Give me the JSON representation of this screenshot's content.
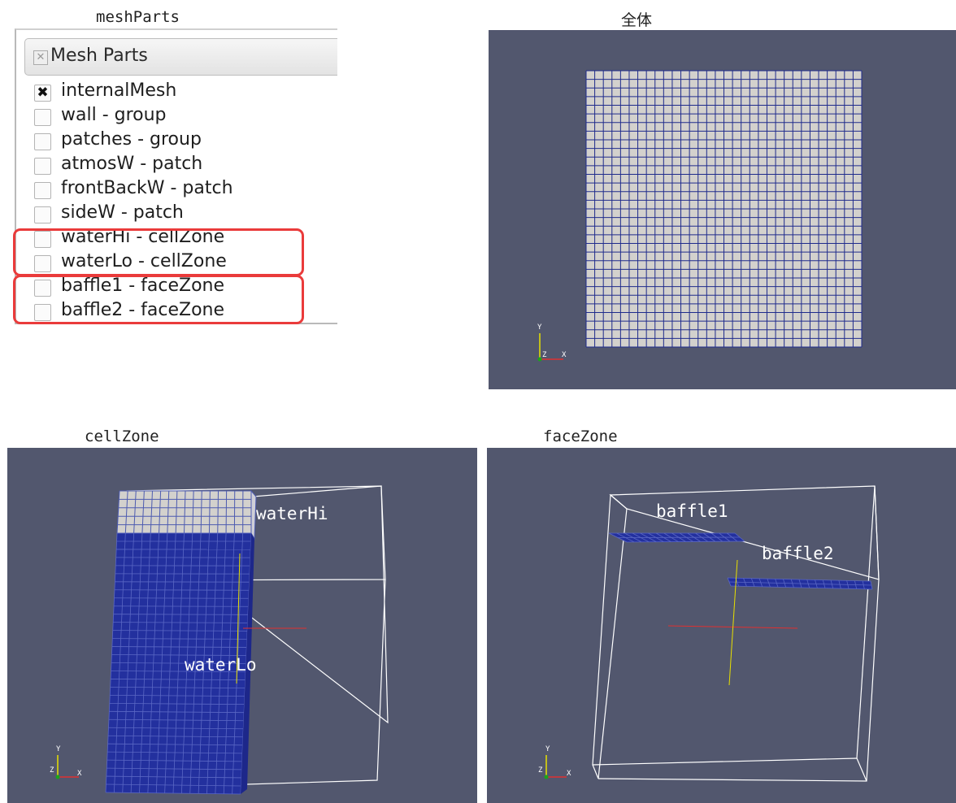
{
  "captions": {
    "meshparts": "meshParts",
    "overall": "全体",
    "cellzone": "cellZone",
    "facezone": "faceZone"
  },
  "mesh_parts_panel": {
    "header": "Mesh Parts",
    "items": [
      {
        "label": "internalMesh",
        "checked": true
      },
      {
        "label": "wall - group",
        "checked": false
      },
      {
        "label": "patches - group",
        "checked": false
      },
      {
        "label": "atmosW - patch",
        "checked": false
      },
      {
        "label": "frontBackW - patch",
        "checked": false
      },
      {
        "label": "sideW - patch",
        "checked": false
      },
      {
        "label": "waterHı - cellZone",
        "checked": false
      },
      {
        "label": "waterLo - cellZone",
        "checked": false
      },
      {
        "label": "baffle1 - faceZone",
        "checked": false
      },
      {
        "label": "baffle2 - faceZone",
        "checked": false
      }
    ],
    "check_glyph": "✖"
  },
  "axes": {
    "y": "Y",
    "z": "Z",
    "x": "X"
  },
  "cellzone_view": {
    "label_hi": "waterHi",
    "label_lo": "waterLo"
  },
  "facezone_view": {
    "label_b1": "baffle1",
    "label_b2": "baffle2"
  },
  "colors": {
    "viewport_bg": "#52576e",
    "mesh_line": "#1f2b8c",
    "mesh_face": "#d3d1cd",
    "zone_fill": "#23309e",
    "highlight": "#ea3b3b"
  }
}
